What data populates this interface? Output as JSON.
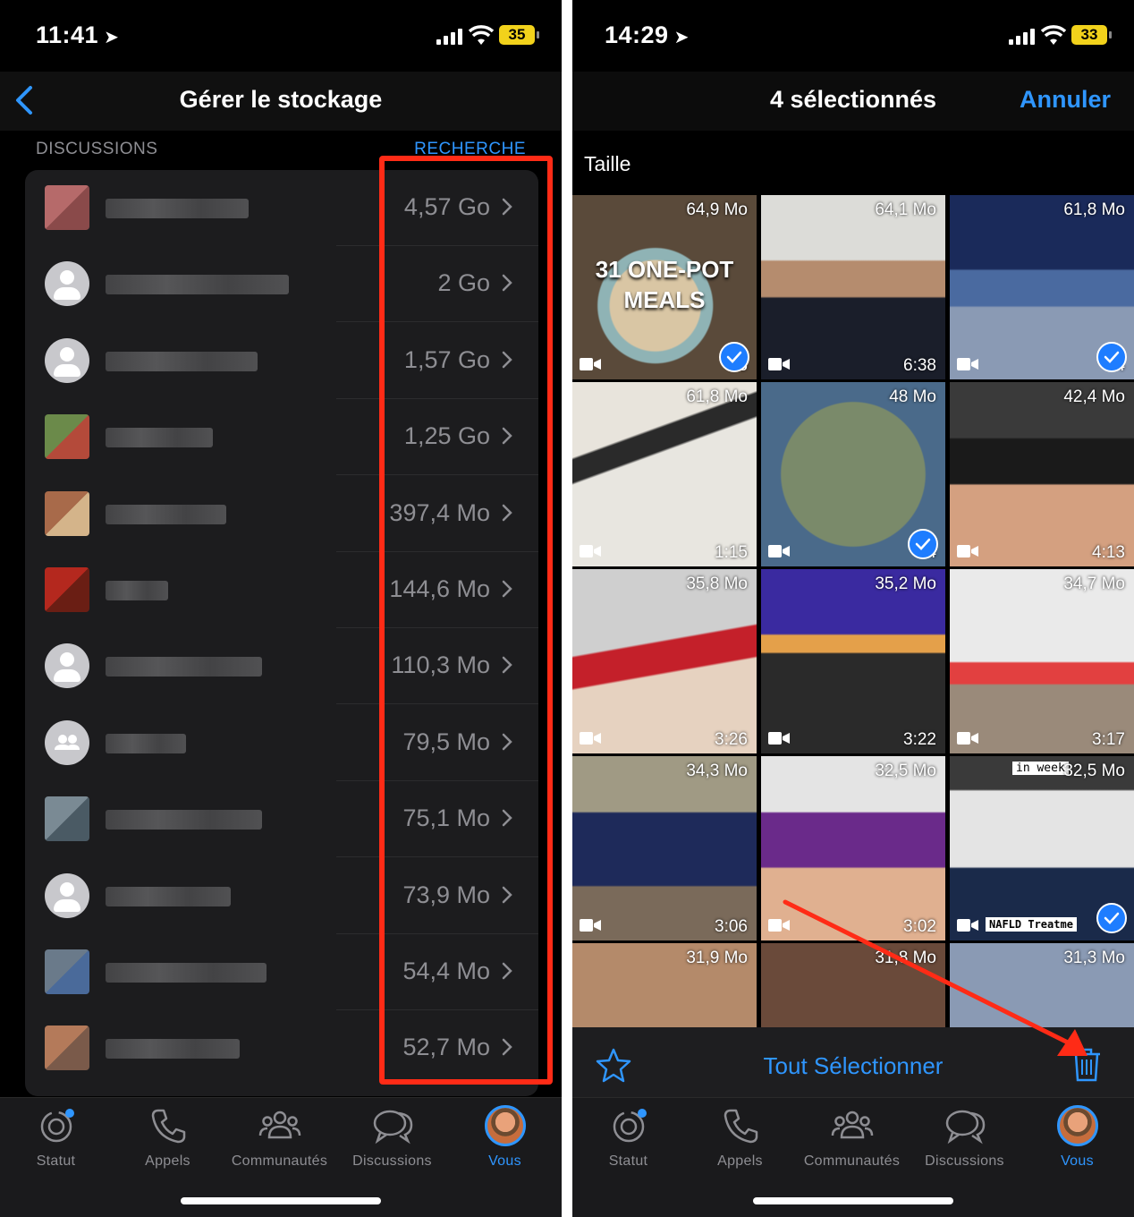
{
  "left": {
    "status": {
      "time": "11:41",
      "battery": "35"
    },
    "header": {
      "title": "Gérer le stockage"
    },
    "section": {
      "label": "DISCUSSIONS",
      "search": "RECHERCHE"
    },
    "chats": [
      {
        "size": "4,57 Go",
        "avatar": "photo"
      },
      {
        "size": "2 Go",
        "avatar": "default"
      },
      {
        "size": "1,57 Go",
        "avatar": "default"
      },
      {
        "size": "1,25 Go",
        "avatar": "photo"
      },
      {
        "size": "397,4 Mo",
        "avatar": "photo"
      },
      {
        "size": "144,6 Mo",
        "avatar": "photo"
      },
      {
        "size": "110,3 Mo",
        "avatar": "default"
      },
      {
        "size": "79,5 Mo",
        "avatar": "group"
      },
      {
        "size": "75,1 Mo",
        "avatar": "photo"
      },
      {
        "size": "73,9 Mo",
        "avatar": "default"
      },
      {
        "size": "54,4 Mo",
        "avatar": "photo"
      },
      {
        "size": "52,7 Mo",
        "avatar": "photo"
      }
    ]
  },
  "right": {
    "status": {
      "time": "14:29",
      "battery": "33"
    },
    "header": {
      "title": "4 sélectionnés",
      "cancel": "Annuler"
    },
    "sort_label": "Taille",
    "media": [
      {
        "size": "64,9 Mo",
        "duration": "18",
        "selected": true,
        "caption": "31 ONE-POT MEALS"
      },
      {
        "size": "64,1 Mo",
        "duration": "6:38",
        "selected": false
      },
      {
        "size": "61,8 Mo",
        "duration": "4",
        "selected": true
      },
      {
        "size": "61,8 Mo",
        "duration": "1:15",
        "selected": false
      },
      {
        "size": "48 Mo",
        "duration": "4",
        "selected": true
      },
      {
        "size": "42,4 Mo",
        "duration": "4:13",
        "selected": false
      },
      {
        "size": "35,8 Mo",
        "duration": "3:26",
        "selected": false
      },
      {
        "size": "35,2 Mo",
        "duration": "3:22",
        "selected": false
      },
      {
        "size": "34,7 Mo",
        "duration": "3:17",
        "selected": false
      },
      {
        "size": "34,3 Mo",
        "duration": "3:06",
        "selected": false
      },
      {
        "size": "32,5 Mo",
        "duration": "3:02",
        "selected": false
      },
      {
        "size": "32,5 Mo",
        "duration": "",
        "selected": true,
        "top_tag": "in week",
        "bottom_tag": "NAFLD Treatme"
      },
      {
        "size": "31,9 Mo",
        "duration": "",
        "selected": false
      },
      {
        "size": "31,8 Mo",
        "duration": "",
        "selected": false
      },
      {
        "size": "31,3 Mo",
        "duration": "",
        "selected": false
      }
    ],
    "actions": {
      "select_all": "Tout Sélectionner"
    }
  },
  "tabs": [
    "Statut",
    "Appels",
    "Communautés",
    "Discussions",
    "Vous"
  ],
  "colors": {
    "accent": "#2f96ff",
    "highlight": "#ff2b16",
    "check": "#1e7dff"
  },
  "icons": [
    "location-arrow-icon",
    "signal-icon",
    "wifi-icon",
    "battery-icon",
    "back-chevron-icon",
    "chevron-right-icon",
    "video-camera-icon",
    "check-icon",
    "star-icon",
    "trash-icon",
    "status-icon",
    "phone-icon",
    "communities-icon",
    "chat-bubbles-icon"
  ]
}
